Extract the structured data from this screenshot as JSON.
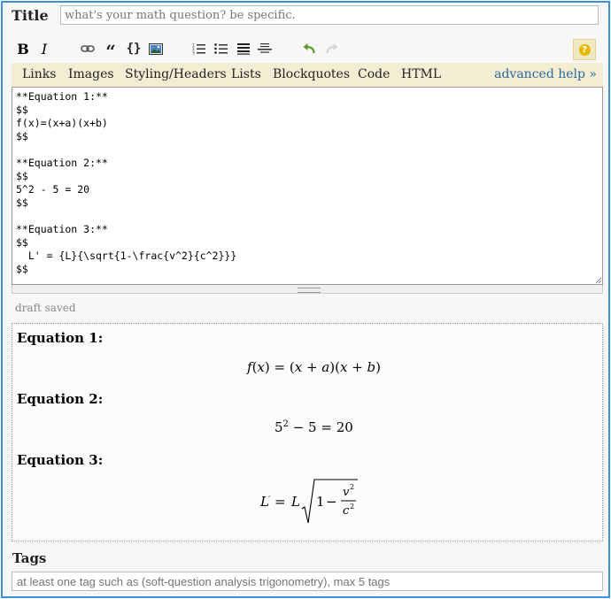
{
  "title": {
    "label": "Title",
    "placeholder": "what's your math question? be specific."
  },
  "toolbar": {
    "bold_label": "B",
    "italic_label": "I",
    "code_label": "{}",
    "quote_label": "“",
    "buttons": [
      "bold-icon",
      "italic-icon",
      "link-icon",
      "blockquote-icon",
      "code-icon",
      "image-icon",
      "numbered-list-icon",
      "bulleted-list-icon",
      "heading-icon",
      "horizontal-rule-icon",
      "undo-icon",
      "redo-icon",
      "help-icon"
    ],
    "help_label": "?"
  },
  "helpbar": {
    "links": [
      "Links",
      "Images",
      "Styling/Headers",
      "Lists",
      "Blockquotes",
      "Code",
      "HTML"
    ],
    "advanced": "advanced help »"
  },
  "editor": {
    "content": "**Equation 1:**\n$$\nf(x)=(x+a)(x+b)\n$$\n\n**Equation 2:**\n$$\n5^2 - 5 = 20\n$$\n\n**Equation 3:**\n$$\n  L' = {L}{\\sqrt{1-\\frac{v^2}{c^2}}}\n$$"
  },
  "status": {
    "draft": "draft saved"
  },
  "preview": {
    "eq1_heading": "Equation 1:",
    "eq2_heading": "Equation 2:",
    "eq3_heading": "Equation 3:",
    "eq2_base": "5",
    "eq2_exp": "2",
    "eq2_rest": "− 5 = 20"
  },
  "tags": {
    "label": "Tags",
    "placeholder": "at least one tag such as (soft-question analysis trigonometry), max 5 tags"
  },
  "colors": {
    "frame_border": "#3d8fd8",
    "helpbar_bg": "#f4ecd3",
    "advanced_link": "#2a6a9c",
    "undo_green": "#5a9a2a",
    "help_yellow": "#e8b700"
  }
}
